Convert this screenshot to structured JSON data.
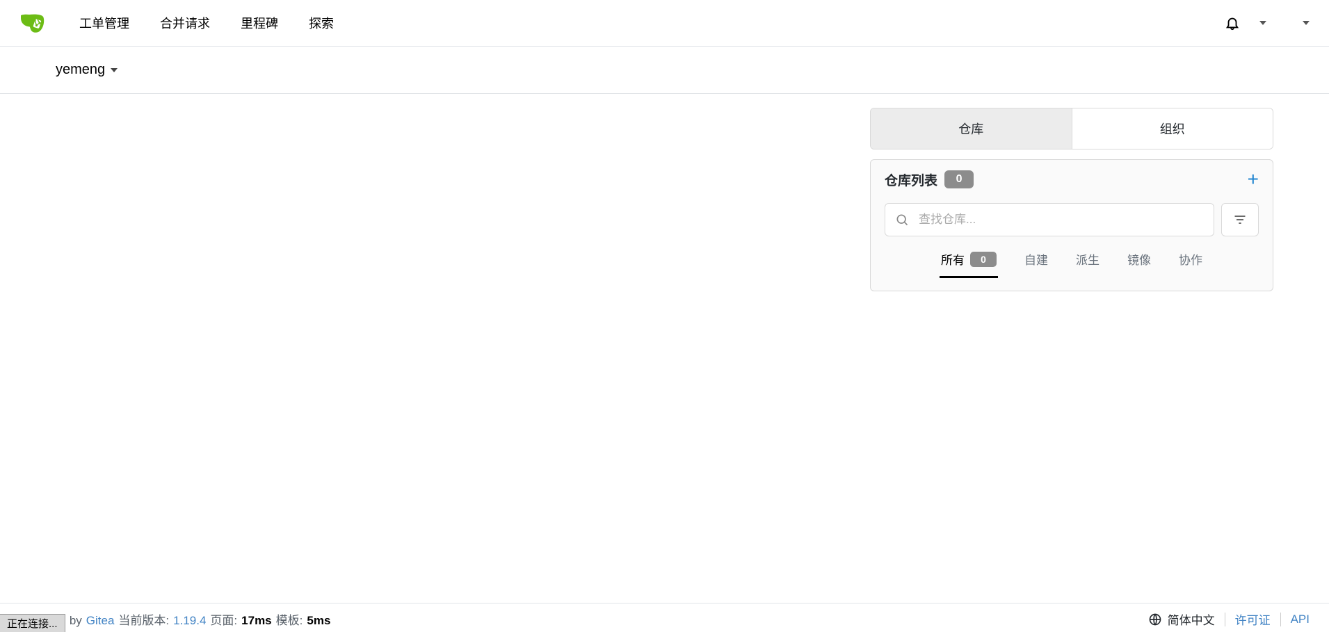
{
  "nav": {
    "items": [
      "工单管理",
      "合并请求",
      "里程碑",
      "探索"
    ]
  },
  "context": {
    "username": "yemeng"
  },
  "side": {
    "tabs": {
      "repos": "仓库",
      "orgs": "组织"
    },
    "panel_title": "仓库列表",
    "panel_count": "0",
    "search_placeholder": "查找仓库...",
    "filters": {
      "all": "所有",
      "all_count": "0",
      "self": "自建",
      "fork": "派生",
      "mirror": "镜像",
      "collab": "协作"
    }
  },
  "footer": {
    "powered_prefix": "Powered by",
    "powered_name": "Gitea",
    "version_label": "当前版本:",
    "version": "1.19.4",
    "page_label": "页面:",
    "page_time": "17ms",
    "tmpl_label": "模板:",
    "tmpl_time": "5ms",
    "lang": "简体中文",
    "license": "许可证",
    "api": "API"
  },
  "status_text": "正在连接..."
}
